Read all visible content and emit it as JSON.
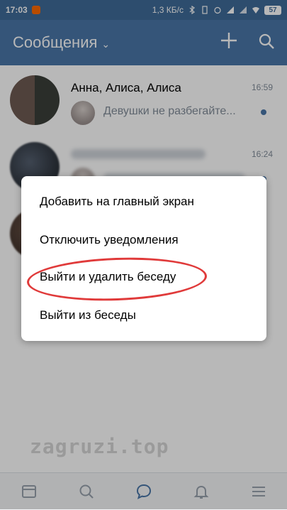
{
  "status_bar": {
    "time": "17:03",
    "network_speed": "1,3 КБ/с",
    "battery": "57"
  },
  "app_bar": {
    "title": "Сообщения",
    "icons": [
      "chevron-down-icon",
      "plus-icon",
      "search-icon"
    ]
  },
  "conversations": [
    {
      "name": "Анна, Алиса, Алиса",
      "time": "16:59",
      "preview": "Девушки не разбегайте...",
      "unread": true
    },
    {
      "time": "16:24",
      "unread": true
    }
  ],
  "context_menu": {
    "items": [
      "Добавить на главный экран",
      "Отключить уведомления",
      "Выйти и удалить беседу",
      "Выйти из беседы"
    ],
    "highlight_color": "#e03a3a"
  },
  "watermark": "zagruzi.top",
  "bottom_nav": [
    "news-icon",
    "search-icon",
    "messages-icon",
    "notifications-icon",
    "menu-icon"
  ],
  "colors": {
    "accent": "#4a76a8",
    "status_bar": "#3f6b99",
    "secondary_text": "#818c99"
  }
}
